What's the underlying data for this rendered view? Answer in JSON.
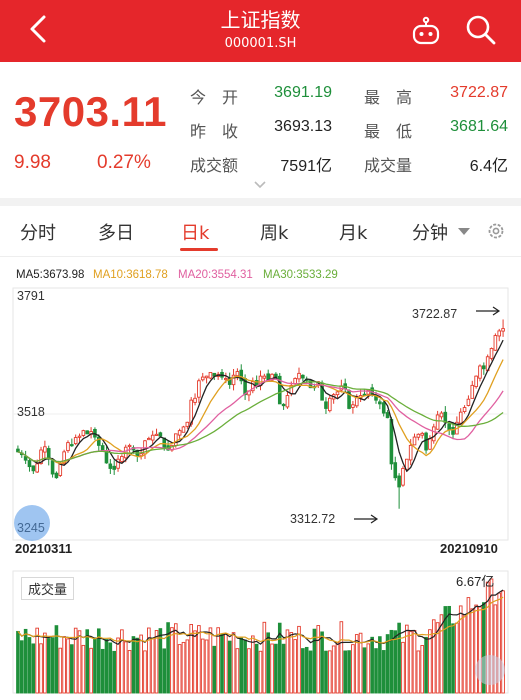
{
  "header": {
    "title": "上证指数",
    "code": "000001.SH",
    "back_icon": "back-arrow-icon",
    "robot_icon": "robot-assistant-icon",
    "search_icon": "search-icon",
    "bg_color": "#e5262b"
  },
  "quote": {
    "price": "3703.11",
    "change": "9.98",
    "change_pct": "0.27%",
    "up_color": "#e43b2c",
    "down_color": "#1e8f3a",
    "stats": [
      {
        "label": "今　开",
        "value": "3691.19"
      },
      {
        "label": "最　高",
        "value": "3722.87"
      },
      {
        "label": "昨　收",
        "value": "3693.13"
      },
      {
        "label": "最　低",
        "value": "3681.64"
      },
      {
        "label": "成交额",
        "value": "7591亿"
      },
      {
        "label": "成交量",
        "value": "6.4亿"
      }
    ]
  },
  "tabs": [
    "分时",
    "多日",
    "日k",
    "周k",
    "月k",
    "分钟"
  ],
  "active_tab": "日k",
  "ma_legend": [
    {
      "label": "MA5:3673.98",
      "color": "#222222"
    },
    {
      "label": "MA10:3618.78",
      "color": "#e0a020"
    },
    {
      "label": "MA20:3554.31",
      "color": "#e060a0"
    },
    {
      "label": "MA30:3533.29",
      "color": "#6aae3a"
    }
  ],
  "chart": {
    "y_top": "3791",
    "y_mid": "3518",
    "y_bottom": "3245",
    "high_label": "3722.87",
    "low_label": "3312.72",
    "start_date": "20210311",
    "end_date": "20210910",
    "volume_label": "成交量",
    "volume_max": "6.67亿"
  },
  "chart_data": {
    "type": "candlestick",
    "x_range": [
      "20210311",
      "20210910"
    ],
    "y_ticks": [
      3791,
      3518,
      3245
    ],
    "annotations": [
      {
        "label": "3722.87",
        "kind": "period-high"
      },
      {
        "label": "3312.72",
        "kind": "period-low"
      }
    ],
    "close": [
      3436,
      3430,
      3418,
      3404,
      3395,
      3410,
      3440,
      3447,
      3420,
      3388,
      3380,
      3410,
      3436,
      3456,
      3450,
      3467,
      3470,
      3482,
      3475,
      3480,
      3468,
      3450,
      3440,
      3412,
      3400,
      3398,
      3420,
      3426,
      3446,
      3450,
      3440,
      3428,
      3432,
      3460,
      3465,
      3472,
      3474,
      3470,
      3446,
      3440,
      3450,
      3475,
      3482,
      3490,
      3500,
      3548,
      3552,
      3590,
      3598,
      3600,
      3608,
      3600,
      3604,
      3598,
      3595,
      3582,
      3602,
      3610,
      3590,
      3560,
      3568,
      3588,
      3580,
      3600,
      3600,
      3590,
      3604,
      3595,
      3540,
      3536,
      3558,
      3580,
      3595,
      3606,
      3596,
      3592,
      3575,
      3576,
      3588,
      3548,
      3530,
      3552,
      3560,
      3566,
      3579,
      3573,
      3530,
      3538,
      3556,
      3558,
      3560,
      3570,
      3560,
      3548,
      3540,
      3520,
      3510,
      3410,
      3380,
      3360,
      3400,
      3420,
      3450,
      3468,
      3474,
      3476,
      3440,
      3465,
      3490,
      3516,
      3520,
      3500,
      3484,
      3474,
      3500,
      3522,
      3532,
      3550,
      3580,
      3600,
      3622,
      3616,
      3642,
      3660,
      3688,
      3698,
      3703
    ],
    "ma_series": [
      {
        "name": "MA5",
        "last": 3673.98
      },
      {
        "name": "MA10",
        "last": 3618.78
      },
      {
        "name": "MA20",
        "last": 3554.31
      },
      {
        "name": "MA30",
        "last": 3533.29
      }
    ],
    "volume_max": 6.67
  }
}
